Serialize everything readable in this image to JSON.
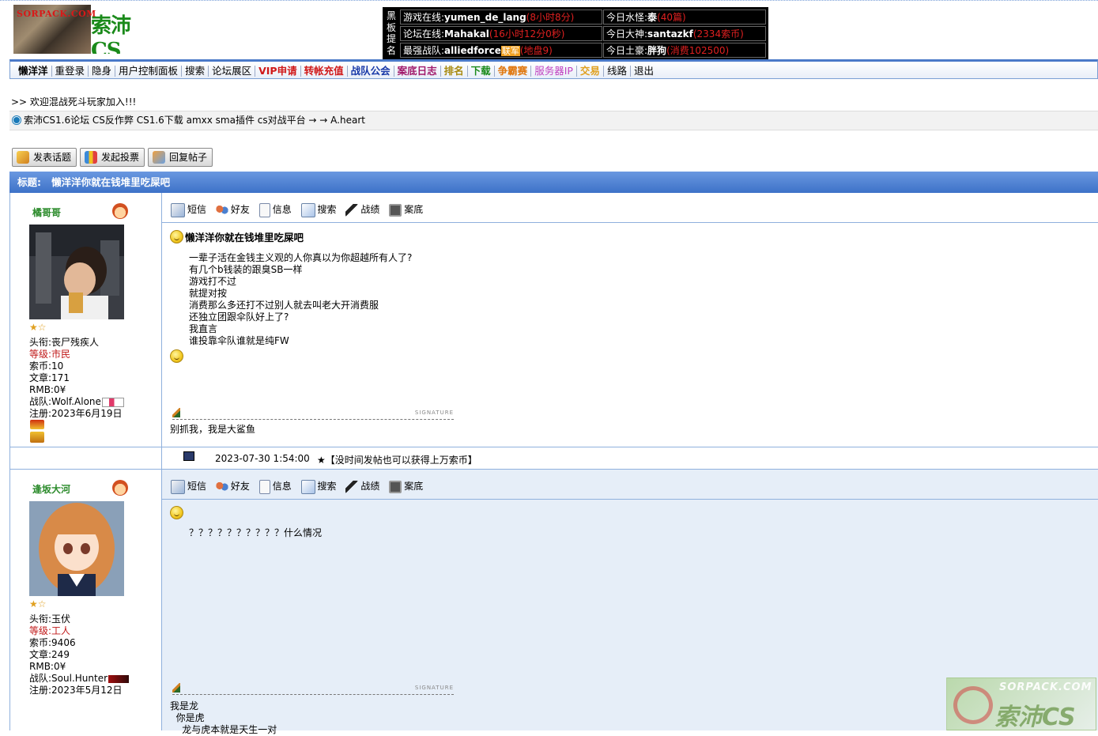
{
  "logo": {
    "site_text": "SORPACK.COM",
    "cs_text": "索沛CS"
  },
  "board": {
    "label": [
      "黑",
      "板",
      "提",
      "名"
    ],
    "rows": [
      {
        "left_label": "游戏在线:",
        "left_name": "yumen_de_lang",
        "left_extra": "(8小时8分)",
        "right_label": "今日水怪:",
        "right_name": "泰",
        "right_extra": "(40篇)"
      },
      {
        "left_label": "论坛在线:",
        "left_name": "Mahakal",
        "left_extra": "(16小时12分0秒)",
        "right_label": "今日大神:",
        "right_name": "santazkf",
        "right_extra": "(2334索币)"
      },
      {
        "left_label": "最强战队:",
        "left_name": "alliedforce",
        "left_tag": "联军",
        "left_extra": "(地盘9)",
        "right_label": "今日土豪:",
        "right_name": "胖狗",
        "right_extra": "(消费102500)"
      }
    ]
  },
  "nav": {
    "items": [
      {
        "label": "懒洋洋",
        "color": "#000000",
        "bold": true
      },
      {
        "label": "重登录",
        "color": "#000000",
        "bold": false
      },
      {
        "label": "隐身",
        "color": "#000000",
        "bold": false
      },
      {
        "label": "用户控制面板",
        "color": "#000000",
        "bold": false
      },
      {
        "label": "搜索",
        "color": "#000000",
        "bold": false
      },
      {
        "label": "论坛展区",
        "color": "#000000",
        "bold": false
      },
      {
        "label": "VIP申请",
        "color": "#d01818",
        "bold": true
      },
      {
        "label": "转帐充值",
        "color": "#d01818",
        "bold": true
      },
      {
        "label": "战队公会",
        "color": "#1a3aa8",
        "bold": true
      },
      {
        "label": "案底日志",
        "color": "#a0186a",
        "bold": true
      },
      {
        "label": "排名",
        "color": "#a88a10",
        "bold": true
      },
      {
        "label": "下载",
        "color": "#1a8a1a",
        "bold": true
      },
      {
        "label": "争霸赛",
        "color": "#e07810",
        "bold": true
      },
      {
        "label": "服务器IP",
        "color": "#c040c0",
        "bold": false
      },
      {
        "label": "交易",
        "color": "#e0a020",
        "bold": true
      },
      {
        "label": "线路",
        "color": "#000000",
        "bold": false
      },
      {
        "label": "退出",
        "color": "#000000",
        "bold": false
      }
    ]
  },
  "welcome": ">> 欢迎混战死斗玩家加入!!!",
  "breadcrumb": "索沛CS1.6论坛 CS反作弊 CS1.6下载 amxx sma插件 cs对战平台 → → A.heart",
  "buttons": {
    "new_topic": "发表话题",
    "new_poll": "发起投票",
    "reply": "回复帖子"
  },
  "thread_title": {
    "label": "标题:",
    "text": "懒洋洋你就在钱堆里吃屎吧"
  },
  "tools": [
    "短信",
    "好友",
    "信息",
    "搜索",
    "战绩",
    "案底"
  ],
  "signature_label": "SIGNATURE",
  "posts": [
    {
      "username": "橘哥哥",
      "stars": "★☆",
      "info": {
        "title_label": "头衔:",
        "title": "丧尸残疾人",
        "level_label": "等级:",
        "level": "市民",
        "coins_label": "索币:",
        "coins": "10",
        "posts_label": "文章:",
        "posts": "171",
        "rmb_label": "RMB:",
        "rmb": "0¥",
        "team_label": "战队:",
        "team": "Wolf.Alone",
        "reg_label": "注册:",
        "reg": "2023年6月19日"
      },
      "post_title": "懒洋洋你就在钱堆里吃屎吧",
      "lines": [
        "一辈子活在金钱主义观的人你真以为你超越所有人了?",
        "有几个b钱装的跟臭SB一样",
        "游戏打不过",
        "就提对按",
        "消费那么多还打不过别人就去叫老大开消费服",
        "还独立团跟伞队好上了?",
        "我直言",
        "谁投靠伞队谁就是纯FW"
      ],
      "signature": [
        "别抓我，我是大鲨鱼"
      ]
    },
    {
      "username": "逢坂大河",
      "stars": "★☆",
      "info": {
        "title_label": "头衔:",
        "title": "玉伏",
        "level_label": "等级:",
        "level": "工人",
        "coins_label": "索币:",
        "coins": "9406",
        "posts_label": "文章:",
        "posts": "249",
        "rmb_label": "RMB:",
        "rmb": "0¥",
        "team_label": "战队:",
        "team": "Soul.Hunter",
        "reg_label": "注册:",
        "reg": "2023年5月12日"
      },
      "lines": [
        "？？？？？？？？？？什么情况"
      ],
      "signature": [
        "我是龙",
        "  你是虎",
        "    龙与虎本就是天生一对"
      ]
    }
  ],
  "post_footer": {
    "time": "2023-07-30 1:54:00",
    "note": "★【没时间发帖也可以获得上万索币】"
  },
  "watermark": {
    "text": "SORPACK.COM",
    "cs": "索沛CS"
  },
  "colors": {
    "nav_border": "#4a79c8",
    "title_bar": "#4a7fd0",
    "post2_bg": "#e6eef8",
    "level_red": "#c01818"
  }
}
